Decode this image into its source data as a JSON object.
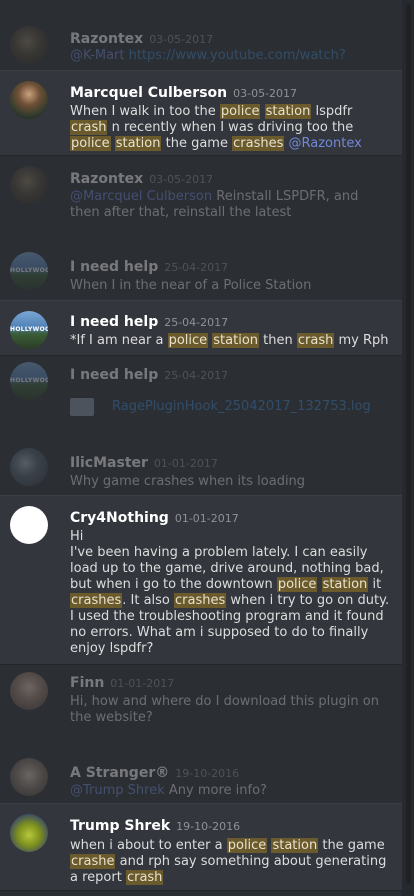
{
  "messages": [
    {
      "name": "Razontex",
      "time": "03-05-2017",
      "mention": "@K-Mart",
      "link": "https://www.youtube.com/watch?"
    },
    {
      "name": "Marcquel Culberson",
      "time": "03-05-2017",
      "line1": [
        "When I walk in too the",
        "police",
        "station",
        "lspdfr"
      ],
      "line2": [
        "crash",
        "n recently when I was driving too the"
      ],
      "line3": [
        "police",
        "station",
        "the game",
        "crashes",
        "@Razontex"
      ]
    },
    {
      "name": "Razontex",
      "time": "03-05-2017",
      "mention": "@Marcquel Culberson",
      "text1": "Reinstall LSPDFR, and",
      "text2": "then after that, reinstall the latest"
    },
    {
      "name": "I need help",
      "time": "25-04-2017",
      "text": "When I in the near of a Police Station"
    },
    {
      "name": "I need help",
      "time": "25-04-2017",
      "parts": [
        "*If I am near a",
        "police",
        "station",
        "then",
        "crash",
        "my Rph"
      ]
    },
    {
      "name": "I need help",
      "time": "25-04-2017",
      "file": "RagePluginHook_25042017_132753.log"
    },
    {
      "name": "IlicMaster",
      "time": "01-01-2017",
      "text": "Why game crashes when its loading"
    },
    {
      "name": "Cry4Nothing",
      "time": "01-01-2017",
      "lines": [
        "Hi",
        "I've been having a problem lately. I can easily",
        "load up to the game, drive around, nothing bad,"
      ],
      "line4": [
        "but when i go to the downtown",
        "police",
        "station",
        "it"
      ],
      "line5": [
        "crashes",
        ". It also",
        "crashes",
        "when i try to go on duty."
      ],
      "lines2": [
        "I used the troubleshooting program and it found",
        "no errors. What am i supposed to do to finally",
        "enjoy lspdfr?"
      ]
    },
    {
      "name": "Finn",
      "time": "01-01-2017",
      "text1": "Hi, how and where do I download this plugin on",
      "text2": "the website?"
    },
    {
      "name": "A Stranger®",
      "time": "19-10-2016",
      "mention": "@Trump Shrek",
      "text": "Any more info?"
    },
    {
      "name": "Trump Shrek",
      "time": "19-10-2016",
      "line1": [
        "when i about to enter a",
        "police",
        "station",
        "the game"
      ],
      "line2": [
        "crashe",
        "and rph say something about generating"
      ],
      "line3": [
        "a report",
        "crash"
      ]
    }
  ],
  "avatars": {
    "hollywood_label": "HOLLYWOOD"
  },
  "colors": {
    "background": "#2b2e33",
    "highlight_row": "#33363c",
    "match": "#6b5a2b",
    "link": "#3f85c9",
    "mention": "#7289da"
  }
}
